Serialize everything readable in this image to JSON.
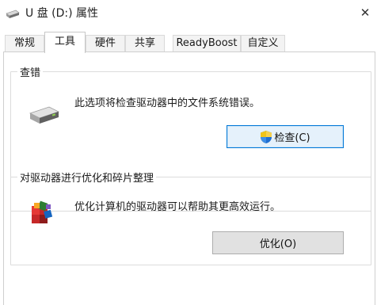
{
  "window": {
    "title": "U 盘 (D:) 属性",
    "close_glyph": "✕"
  },
  "tabs": [
    {
      "label": "常规"
    },
    {
      "label": "工具",
      "active": true
    },
    {
      "label": "硬件"
    },
    {
      "label": "共享"
    },
    {
      "label": "ReadyBoost"
    },
    {
      "label": "自定义"
    }
  ],
  "check": {
    "title": "查错",
    "description": "此选项将检查驱动器中的文件系统错误。",
    "button_label": "检查(C)",
    "icon": "drive-icon"
  },
  "optimize": {
    "title": "对驱动器进行优化和碎片整理",
    "description": "优化计算机的驱动器可以帮助其更高效运行。",
    "button_label": "优化(O)",
    "icon": "defrag-icon"
  },
  "colors": {
    "accent": "#0078d7",
    "button_bg": "#e1e1e1"
  }
}
